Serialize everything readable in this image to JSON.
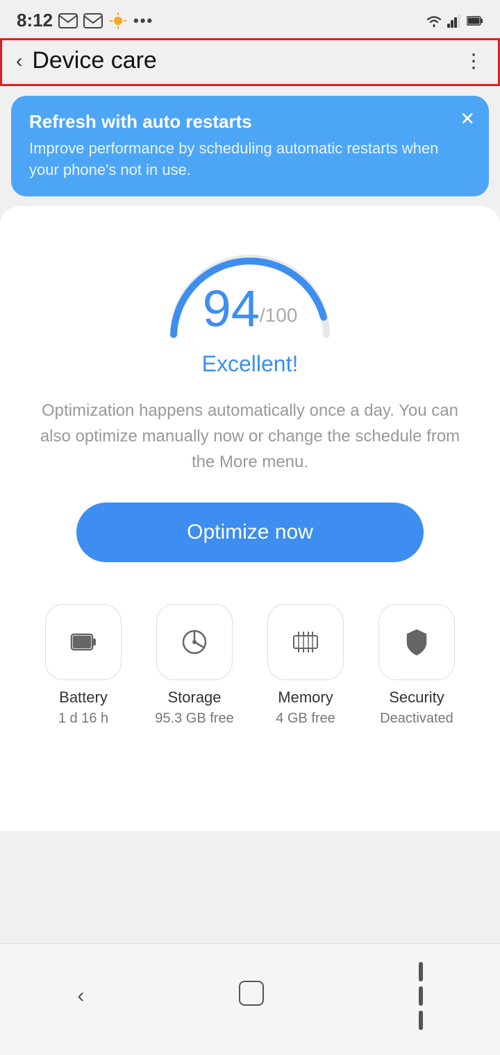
{
  "statusBar": {
    "time": "8:12",
    "icons": [
      "email",
      "gmail",
      "weather",
      "more",
      "wifi",
      "signal",
      "battery"
    ]
  },
  "header": {
    "backLabel": "‹",
    "title": "Device care",
    "moreLabel": "⋮"
  },
  "banner": {
    "title": "Refresh with auto restarts",
    "description": "Improve performance by scheduling automatic restarts when your phone's not in use.",
    "closeLabel": "✕"
  },
  "score": {
    "value": "94",
    "max": "/100",
    "label": "Excellent!"
  },
  "description": "Optimization happens automatically once a day.\nYou can also optimize manually now or change the\nschedule from the More menu.",
  "optimizeButton": "Optimize now",
  "bottomItems": [
    {
      "id": "battery",
      "label": "Battery",
      "sublabel": "1 d 16 h",
      "icon": "battery"
    },
    {
      "id": "storage",
      "label": "Storage",
      "sublabel": "95.3 GB free",
      "icon": "storage"
    },
    {
      "id": "memory",
      "label": "Memory",
      "sublabel": "4 GB free",
      "icon": "memory"
    },
    {
      "id": "security",
      "label": "Security",
      "sublabel": "Deactivated",
      "icon": "security"
    }
  ],
  "bottomNav": {
    "back": "‹",
    "home": "",
    "recent": ""
  }
}
